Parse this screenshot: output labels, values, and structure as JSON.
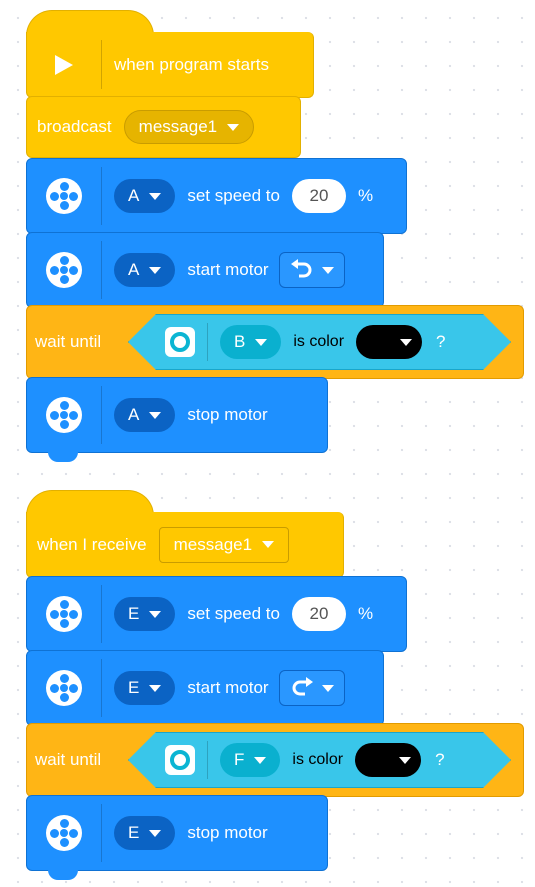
{
  "stack1": {
    "hat": {
      "label": "when program starts",
      "icon": "play-icon"
    },
    "broadcast": {
      "label": "broadcast",
      "message": "message1"
    },
    "set_speed": {
      "port": "A",
      "label": "set speed to",
      "value": "20",
      "unit": "%"
    },
    "start_motor": {
      "port": "A",
      "label": "start motor",
      "direction_icon": "counterclockwise-arrow-icon"
    },
    "wait_until": {
      "label": "wait until",
      "sensor_port": "B",
      "is_color_label": "is color",
      "color": "#000000",
      "question": "?"
    },
    "stop_motor": {
      "port": "A",
      "label": "stop motor"
    }
  },
  "stack2": {
    "hat": {
      "label": "when I receive",
      "message": "message1"
    },
    "set_speed": {
      "port": "E",
      "label": "set speed to",
      "value": "20",
      "unit": "%"
    },
    "start_motor": {
      "port": "E",
      "label": "start motor",
      "direction_icon": "clockwise-arrow-icon"
    },
    "wait_until": {
      "label": "wait until",
      "sensor_port": "F",
      "is_color_label": "is color",
      "color": "#000000",
      "question": "?"
    },
    "stop_motor": {
      "port": "E",
      "label": "stop motor"
    }
  },
  "colors": {
    "events_yellow": "#ffc800",
    "control_orange": "#ffb515",
    "motor_blue": "#1e90ff",
    "sensor_cyan": "#39c6ea"
  }
}
